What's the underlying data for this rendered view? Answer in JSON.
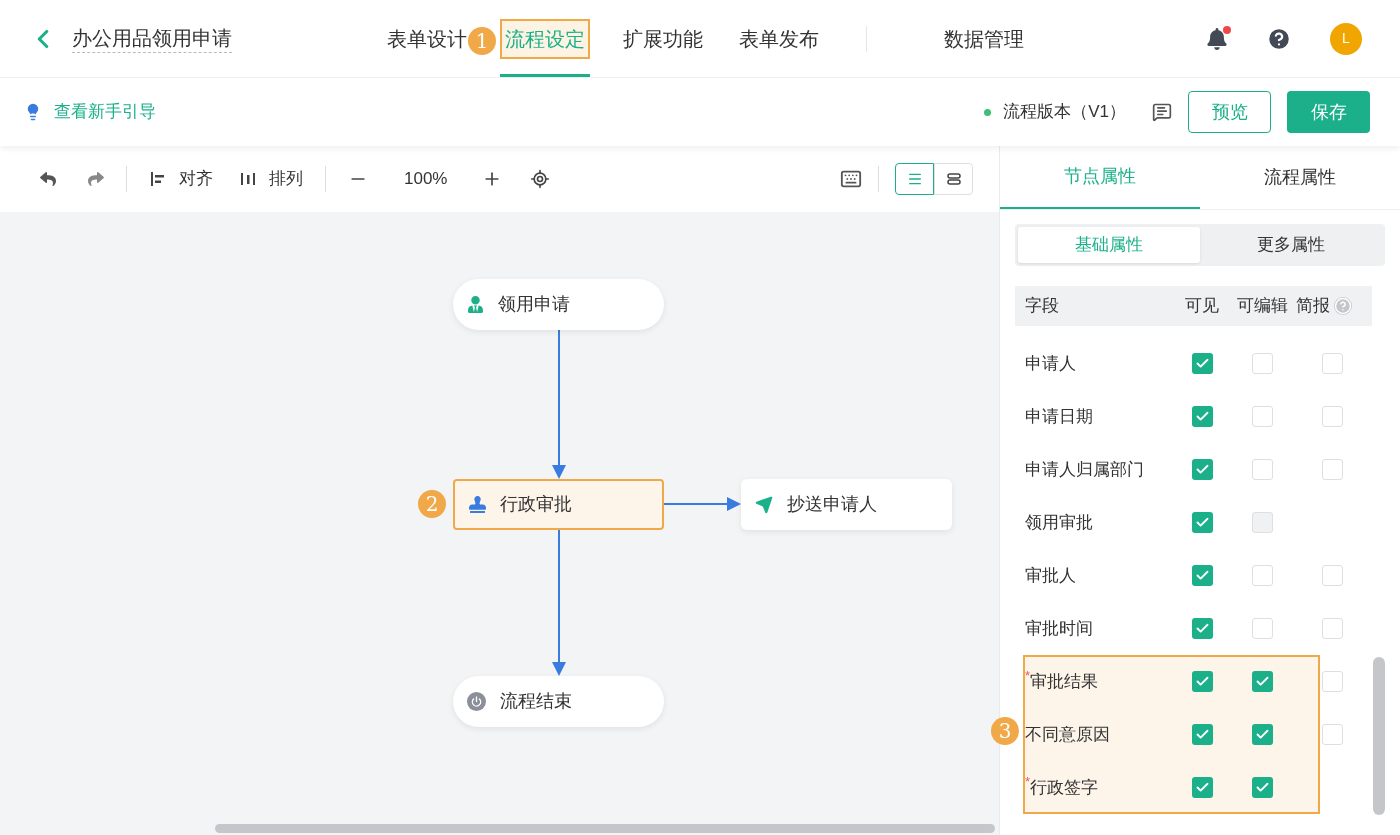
{
  "header": {
    "title": "办公用品领用申请",
    "tabs": [
      {
        "label": "表单设计",
        "selected": false
      },
      {
        "label": "流程设定",
        "selected": true,
        "callout": "1"
      },
      {
        "label": "扩展功能",
        "selected": false
      },
      {
        "label": "表单发布",
        "selected": false
      },
      {
        "label": "数据管理",
        "selected": false
      }
    ],
    "notification_dot": true,
    "avatar": "L"
  },
  "subbar": {
    "guide_link": "查看新手引导",
    "version": "流程版本（V1）",
    "buttons": [
      {
        "label": "预览",
        "kind": "outline"
      },
      {
        "label": "保存",
        "kind": "primary"
      }
    ]
  },
  "toolbar": {
    "align": "对齐",
    "arrange": "排列",
    "zoom": "100%",
    "view_modes": [
      {
        "selected": true
      },
      {
        "selected": false
      }
    ]
  },
  "nodes": [
    {
      "label": "领用申请",
      "kind": "start",
      "selected": false
    },
    {
      "label": "行政审批",
      "kind": "approve",
      "selected": true,
      "callout": "2"
    },
    {
      "label": "抄送申请人",
      "kind": "cc",
      "selected": false
    },
    {
      "label": "流程结束",
      "kind": "end",
      "selected": false
    }
  ],
  "panel": {
    "tabs": [
      {
        "label": "节点属性",
        "selected": true
      },
      {
        "label": "流程属性",
        "selected": false
      }
    ],
    "segments": [
      {
        "label": "基础属性",
        "selected": true
      },
      {
        "label": "更多属性",
        "selected": false
      }
    ],
    "columns": [
      "字段",
      "可见",
      "可编辑",
      "简报"
    ],
    "callout": "3",
    "required_mark": "*",
    "rows": [
      {
        "name": "申请人",
        "required": false,
        "highlighted": false,
        "visible": true,
        "editable": false,
        "brief": false
      },
      {
        "name": "申请日期",
        "required": false,
        "highlighted": false,
        "visible": true,
        "editable": false,
        "brief": false
      },
      {
        "name": "申请人归属部门",
        "required": false,
        "highlighted": false,
        "visible": true,
        "editable": false,
        "brief": false
      },
      {
        "name": "领用审批",
        "required": false,
        "highlighted": false,
        "visible": true,
        "editable": false,
        "editable_disabled": true
      },
      {
        "name": "审批人",
        "required": false,
        "highlighted": false,
        "visible": true,
        "editable": false,
        "brief": false
      },
      {
        "name": "审批时间",
        "required": false,
        "highlighted": false,
        "visible": true,
        "editable": false,
        "brief": false
      },
      {
        "name": "审批结果",
        "required": true,
        "highlighted": true,
        "visible": true,
        "editable": true,
        "brief": false
      },
      {
        "name": "不同意原因",
        "required": false,
        "highlighted": true,
        "visible": true,
        "editable": true,
        "brief": false
      },
      {
        "name": "行政签字",
        "required": true,
        "highlighted": true,
        "visible": true,
        "editable": true
      }
    ]
  }
}
